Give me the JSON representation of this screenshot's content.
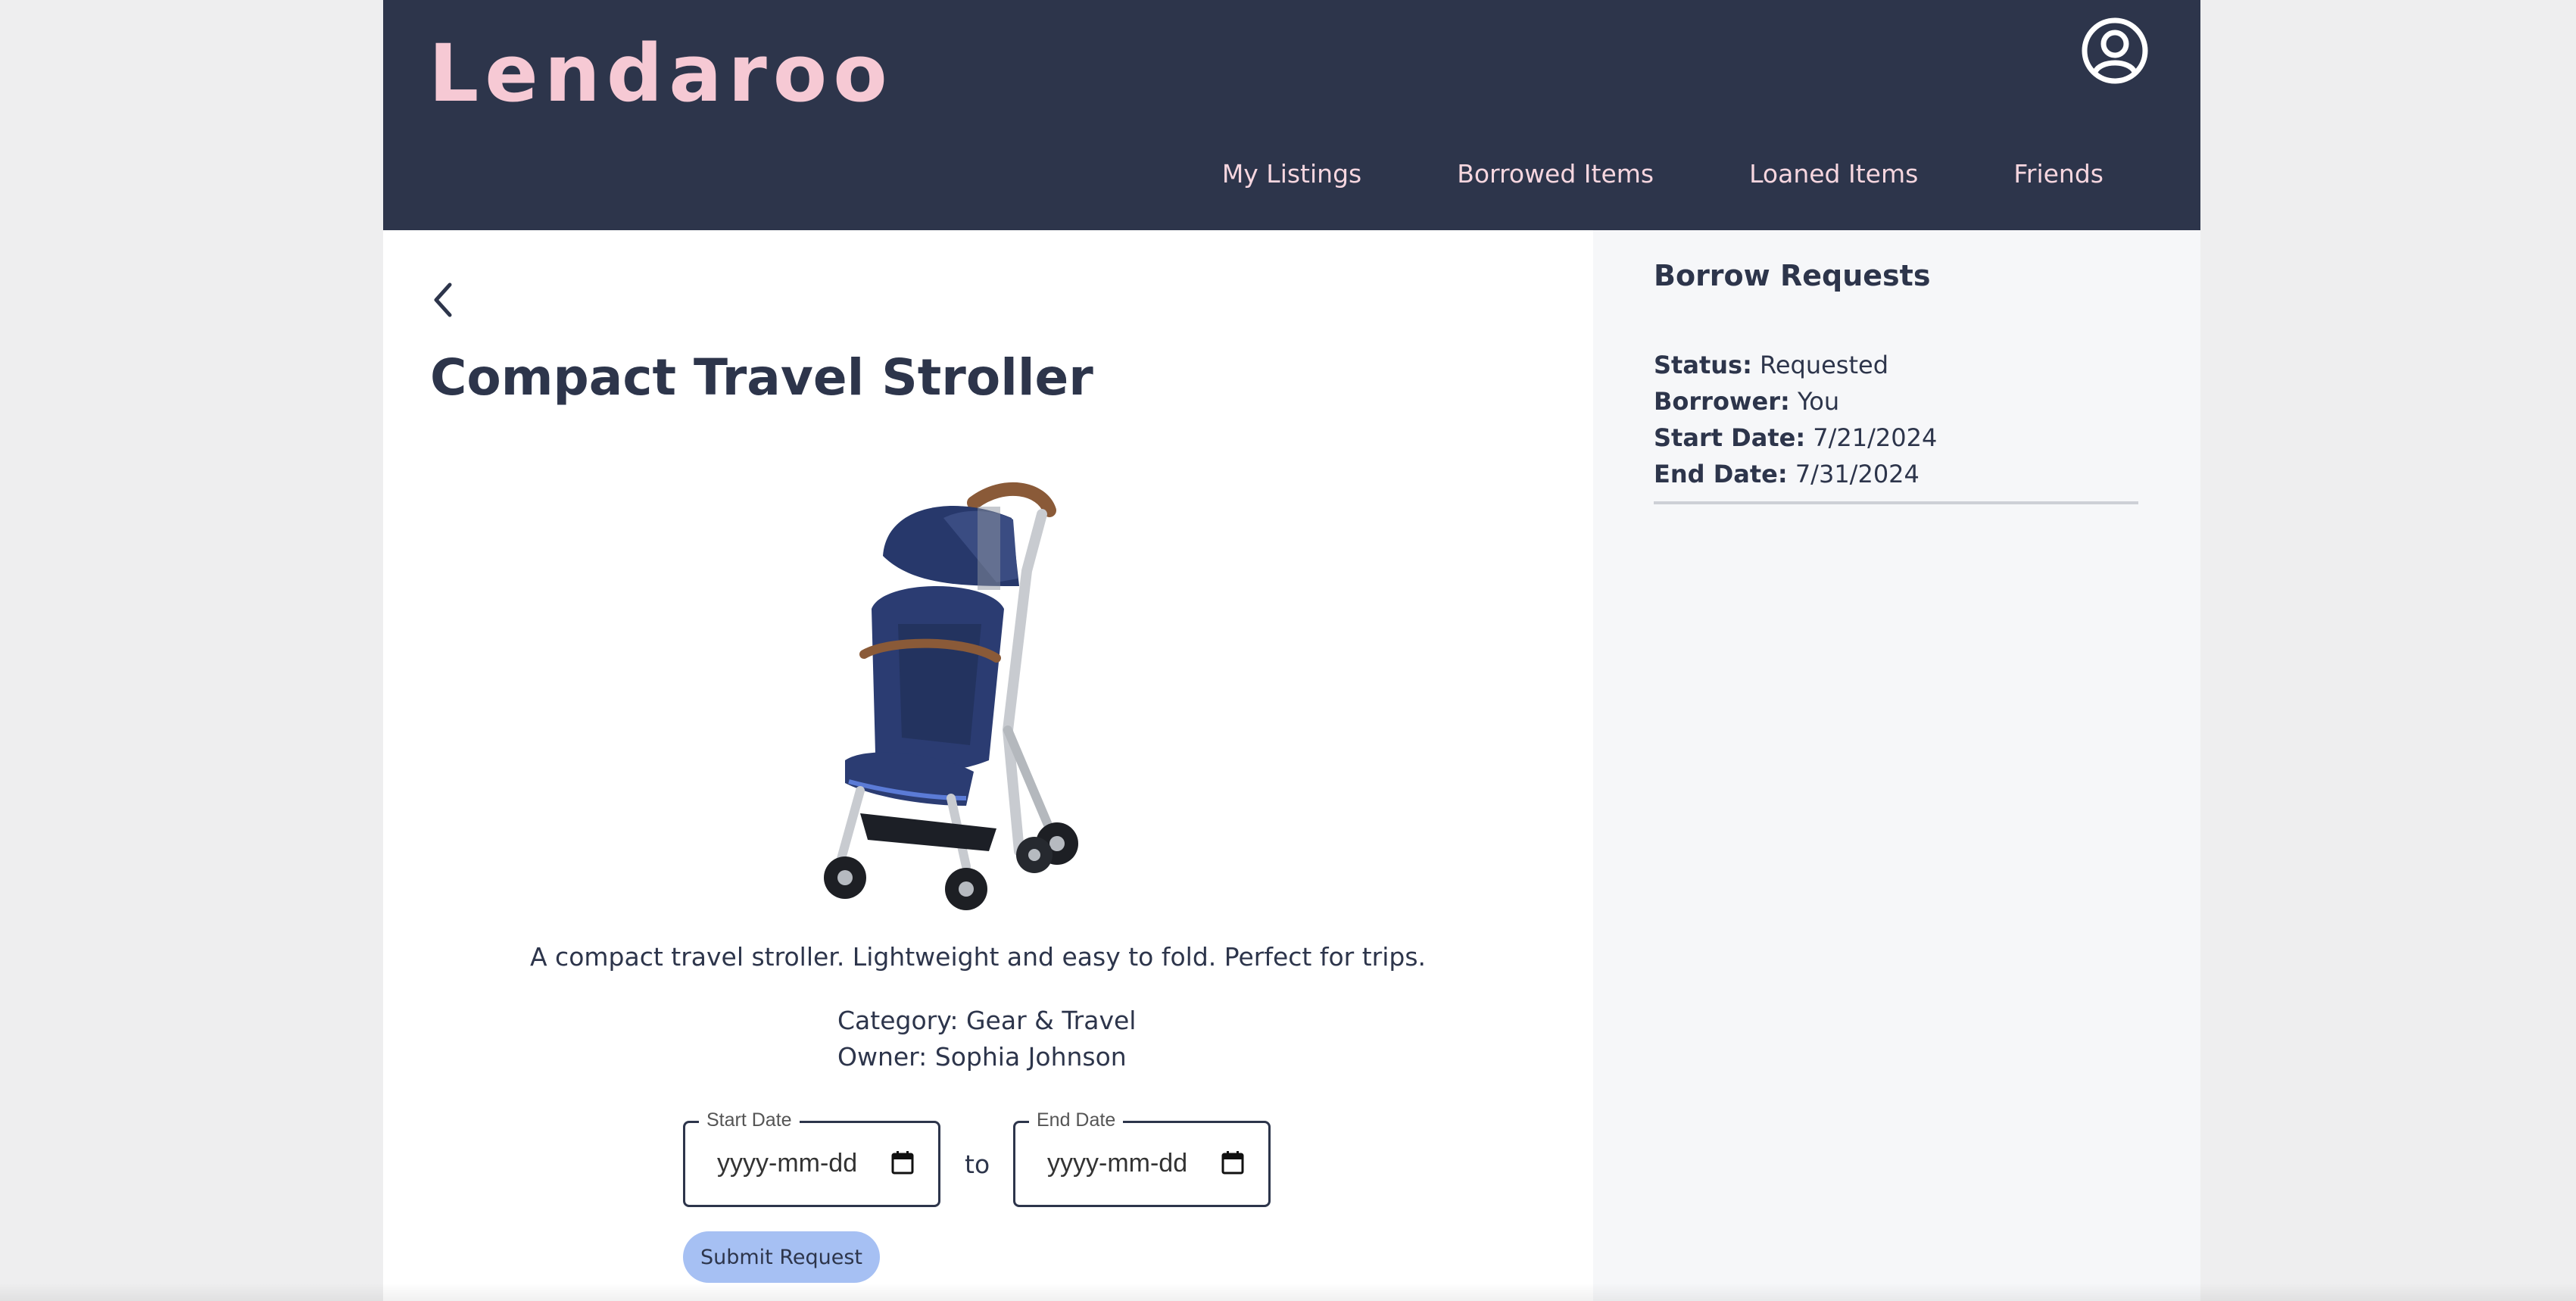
{
  "app": {
    "logo": "Lendaroo",
    "icons": {
      "profile": "user-circle-icon",
      "back": "chevron-left-icon",
      "calendar": "calendar-icon"
    },
    "colors": {
      "header_bg": "#2d354b",
      "logo": "#f6c9d4",
      "nav_text": "#f6d6df",
      "accent_button": "#a6c0f3",
      "sidebar_bg": "#f6f7f9"
    }
  },
  "nav": {
    "items": [
      {
        "label": "My Listings"
      },
      {
        "label": "Borrowed Items"
      },
      {
        "label": "Loaned Items"
      },
      {
        "label": "Friends"
      }
    ]
  },
  "item": {
    "title": "Compact Travel Stroller",
    "description": "A compact travel stroller. Lightweight and easy to fold. Perfect for trips.",
    "category_label": "Category:",
    "category": "Gear & Travel",
    "owner_label": "Owner:",
    "owner": "Sophia Johnson"
  },
  "form": {
    "start_label": "Start Date",
    "start_placeholder": "yyyy-mm-dd",
    "to": "to",
    "end_label": "End Date",
    "end_placeholder": "yyyy-mm-dd",
    "submit": "Submit Request"
  },
  "sidebar": {
    "title": "Borrow Requests",
    "requests": [
      {
        "status_label": "Status:",
        "status": "Requested",
        "borrower_label": "Borrower:",
        "borrower": "You",
        "start_label": "Start Date:",
        "start": "7/21/2024",
        "end_label": "End Date:",
        "end": "7/31/2024"
      }
    ]
  }
}
